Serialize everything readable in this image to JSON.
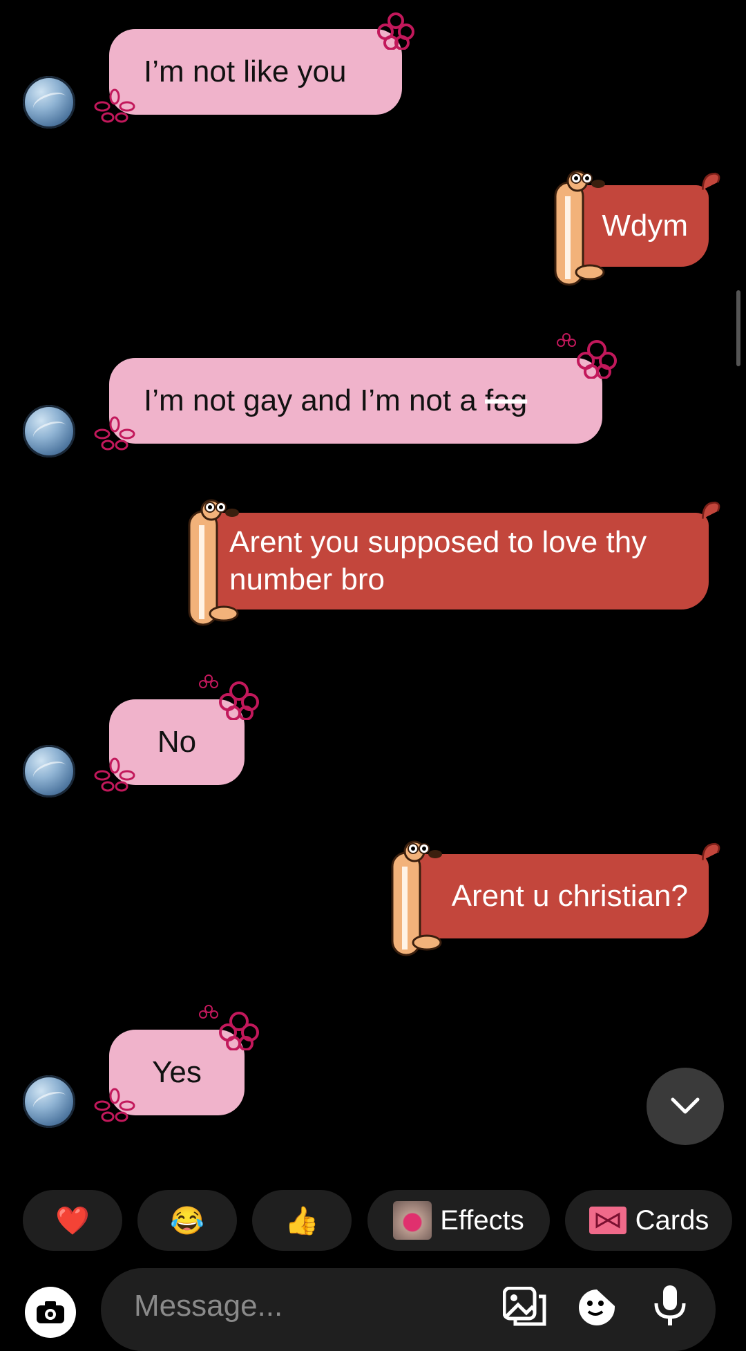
{
  "messages": [
    {
      "from": "them",
      "text": "I’m not like you"
    },
    {
      "from": "me",
      "text": "Wdym"
    },
    {
      "from": "them",
      "text": "I’m not gay and I’m not a",
      "struck": "fag"
    },
    {
      "from": "me",
      "text": "Arent you supposed to love thy number bro"
    },
    {
      "from": "them",
      "text": "No"
    },
    {
      "from": "me",
      "text": "Arent u christian?"
    },
    {
      "from": "them",
      "text": "Yes"
    }
  ],
  "quick_reactions": [
    {
      "icon": "heart-icon",
      "glyph": "❤️"
    },
    {
      "icon": "laughing-face-icon",
      "glyph": "😂"
    },
    {
      "icon": "thumbs-up-icon",
      "glyph": "👍"
    }
  ],
  "chips": {
    "effects_label": "Effects",
    "cards_label": "Cards"
  },
  "composer": {
    "placeholder": "Message..."
  },
  "colors": {
    "incoming": "#f0b3cb",
    "outgoing": "#c3463c",
    "background": "#000000"
  }
}
